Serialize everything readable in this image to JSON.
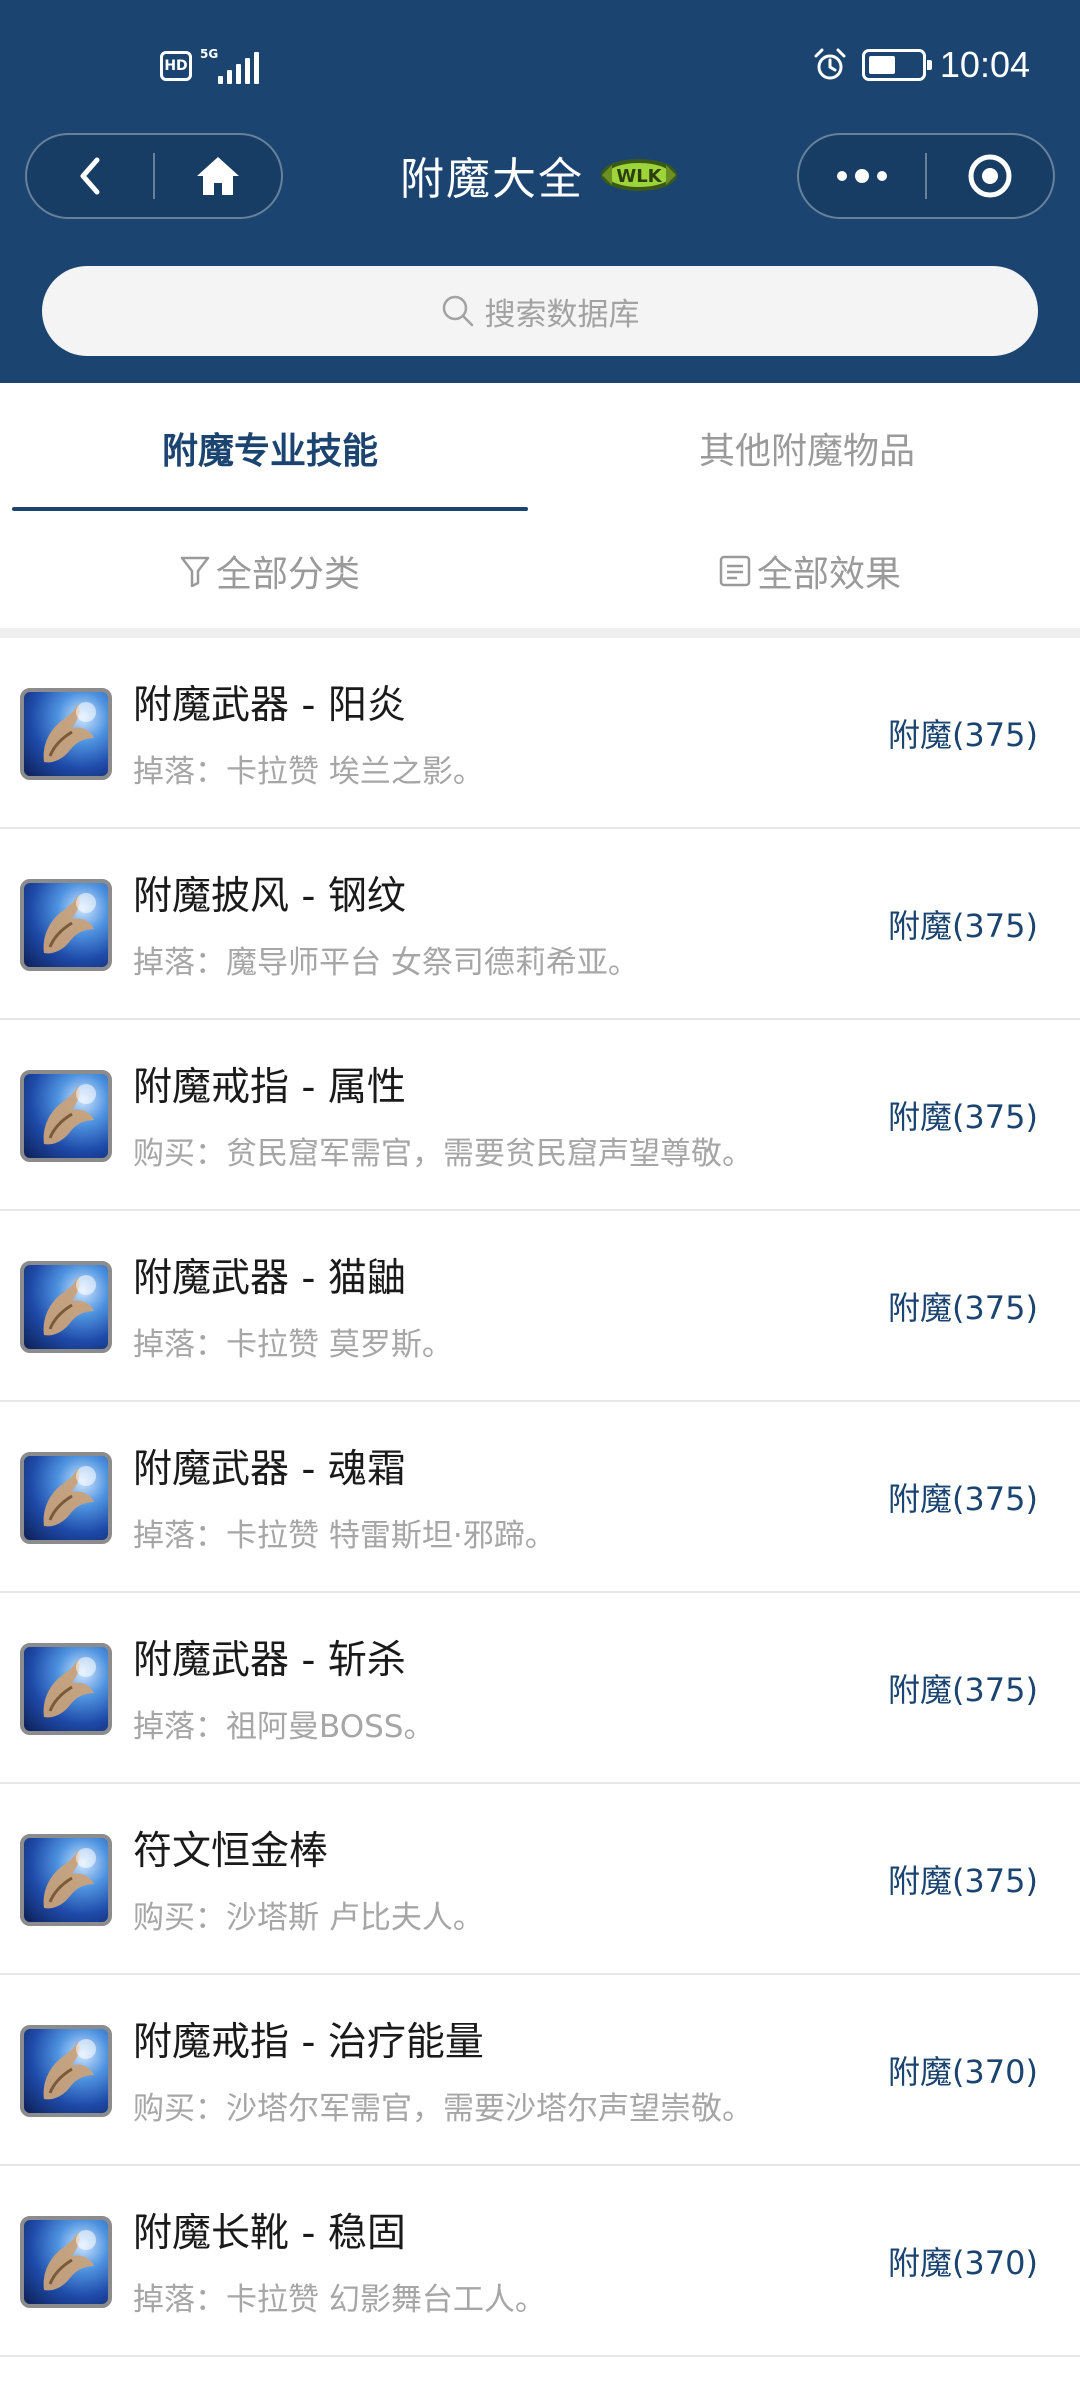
{
  "status_bar": {
    "hd": "HD",
    "network": "5G",
    "time": "10:04",
    "icons": [
      "hd-icon",
      "signal-icon",
      "alarm-icon",
      "battery-icon"
    ]
  },
  "nav": {
    "back_icon": "chevron-left-icon",
    "home_icon": "home-icon",
    "more_icon": "more-dots-icon",
    "close_icon": "target-close-icon"
  },
  "header": {
    "title": "附魔大全",
    "badge_text": "WLK"
  },
  "search": {
    "placeholder": "搜索数据库",
    "icon": "search-icon"
  },
  "tabs": [
    {
      "label": "附魔专业技能",
      "active": true
    },
    {
      "label": "其他附魔物品",
      "active": false
    }
  ],
  "filters": [
    {
      "label": "全部分类",
      "icon": "filter-icon"
    },
    {
      "label": "全部效果",
      "icon": "list-icon"
    }
  ],
  "items": [
    {
      "name": "附魔武器 - 阳炎",
      "source": "掉落：卡拉赞 埃兰之影。",
      "skill": "附魔(375)"
    },
    {
      "name": "附魔披风 - 钢纹",
      "source": "掉落：魔导师平台 女祭司德莉希亚。",
      "skill": "附魔(375)"
    },
    {
      "name": "附魔戒指 - 属性",
      "source": "购买：贫民窟军需官，需要贫民窟声望尊敬。",
      "skill": "附魔(375)"
    },
    {
      "name": "附魔武器 - 猫鼬",
      "source": "掉落：卡拉赞 莫罗斯。",
      "skill": "附魔(375)"
    },
    {
      "name": "附魔武器 - 魂霜",
      "source": "掉落：卡拉赞 特雷斯坦·邪蹄。",
      "skill": "附魔(375)"
    },
    {
      "name": "附魔武器 - 斩杀",
      "source": "掉落：祖阿曼BOSS。",
      "skill": "附魔(375)"
    },
    {
      "name": "符文恒金棒",
      "source": "购买：沙塔斯 卢比夫人。",
      "skill": "附魔(375)"
    },
    {
      "name": "附魔戒指 - 治疗能量",
      "source": "购买：沙塔尔军需官，需要沙塔尔声望崇敬。",
      "skill": "附魔(370)"
    },
    {
      "name": "附魔长靴 - 稳固",
      "source": "掉落：卡拉赞 幻影舞台工人。",
      "skill": "附魔(370)"
    }
  ],
  "colors": {
    "header_bg": "#1b4470",
    "accent": "#1b4470",
    "muted_text": "#a6a6a6"
  }
}
